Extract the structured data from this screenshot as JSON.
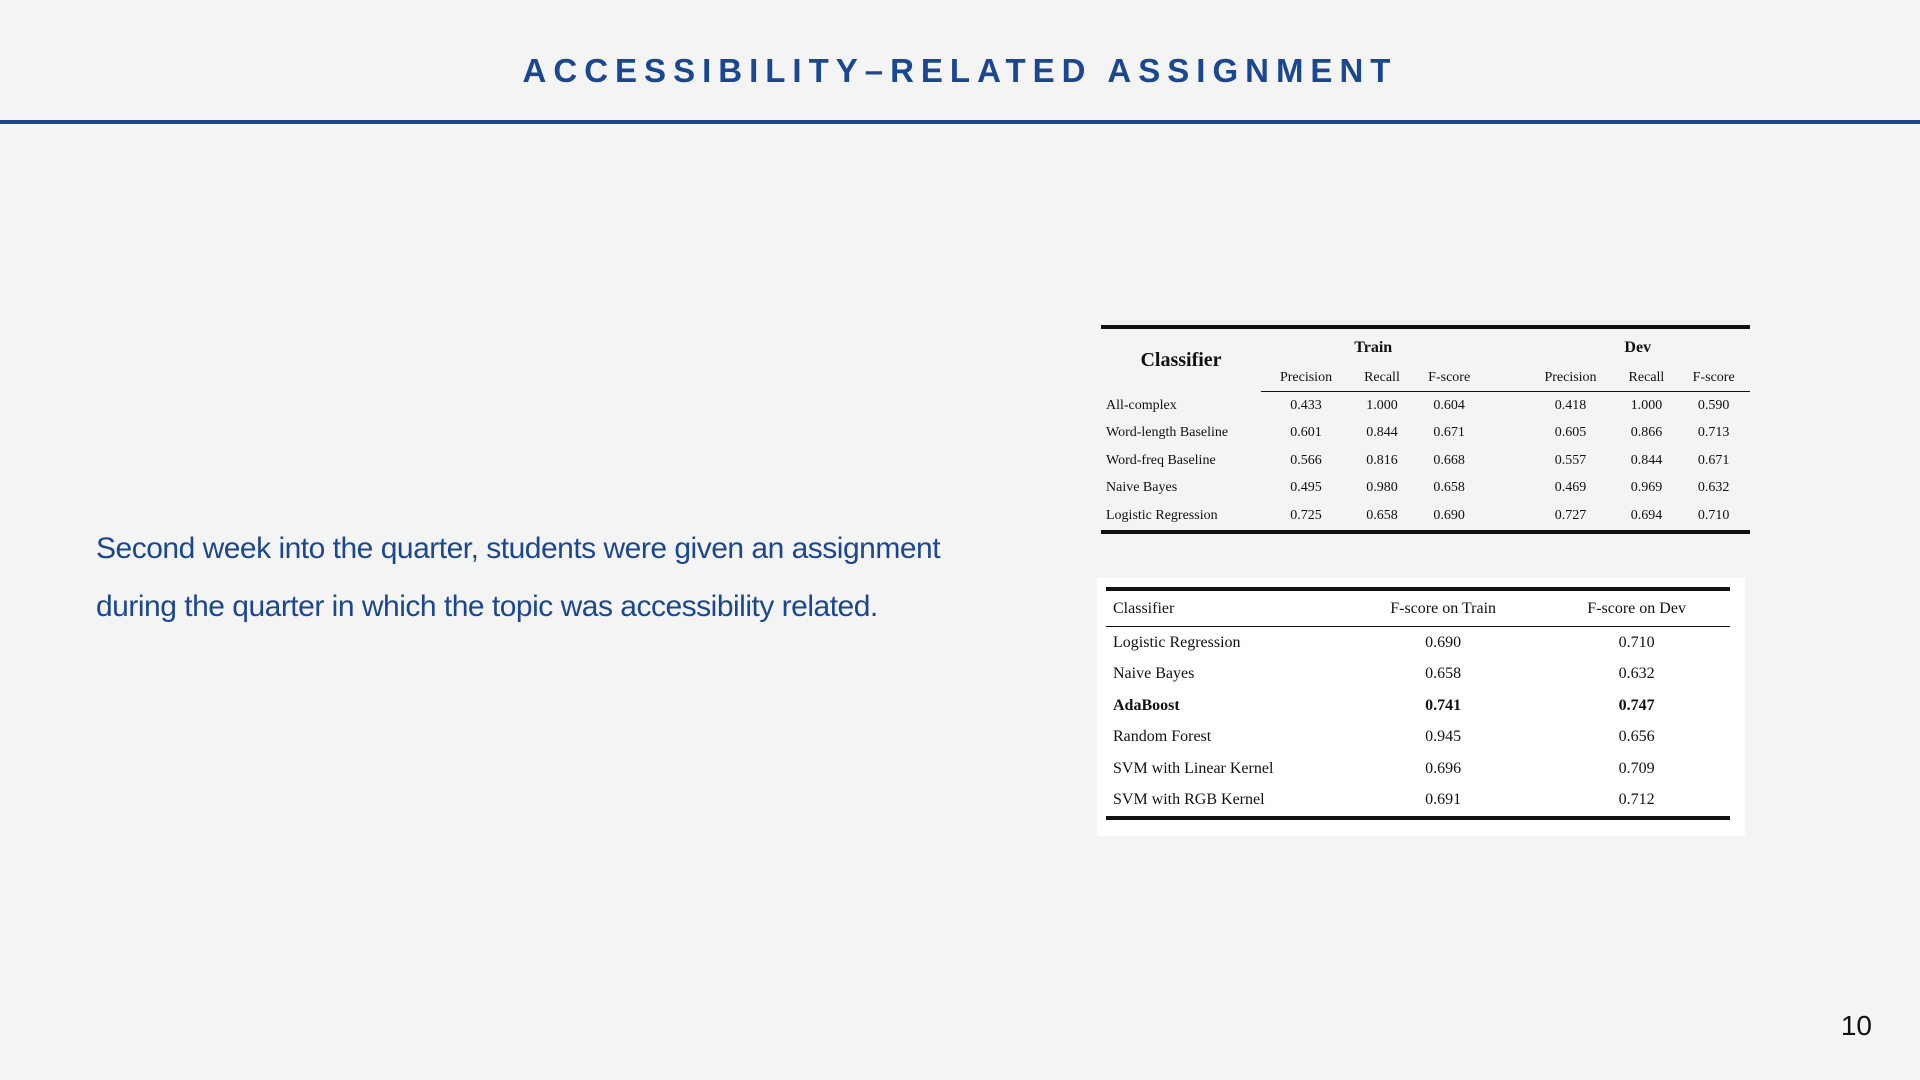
{
  "slide": {
    "title": "ACCESSIBILITY–RELATED ASSIGNMENT",
    "body_lines": [
      "Second week into the quarter, students were given an assignment",
      "during the quarter in which the topic was accessibility related."
    ],
    "page_number": "10"
  },
  "table1": {
    "classifier_header": "Classifier",
    "groups": [
      "Train",
      "Dev"
    ],
    "subheaders": [
      "Precision",
      "Recall",
      "F-score",
      "Precision",
      "Recall",
      "F-score"
    ],
    "rows": [
      {
        "name": "All-complex",
        "values": [
          "0.433",
          "1.000",
          "0.604",
          "0.418",
          "1.000",
          "0.590"
        ]
      },
      {
        "name": "Word-length Baseline",
        "values": [
          "0.601",
          "0.844",
          "0.671",
          "0.605",
          "0.866",
          "0.713"
        ]
      },
      {
        "name": "Word-freq Baseline",
        "values": [
          "0.566",
          "0.816",
          "0.668",
          "0.557",
          "0.844",
          "0.671"
        ]
      },
      {
        "name": "Naive Bayes",
        "values": [
          "0.495",
          "0.980",
          "0.658",
          "0.469",
          "0.969",
          "0.632"
        ]
      },
      {
        "name": "Logistic Regression",
        "values": [
          "0.725",
          "0.658",
          "0.690",
          "0.727",
          "0.694",
          "0.710"
        ]
      }
    ]
  },
  "table2": {
    "headers": [
      "Classifier",
      "F-score on Train",
      "F-score on Dev"
    ],
    "rows": [
      {
        "name": "Logistic Regression",
        "train": "0.690",
        "dev": "0.710",
        "bold": false
      },
      {
        "name": "Naive Bayes",
        "train": "0.658",
        "dev": "0.632",
        "bold": false
      },
      {
        "name": "AdaBoost",
        "train": "0.741",
        "dev": "0.747",
        "bold": true
      },
      {
        "name": "Random Forest",
        "train": "0.945",
        "dev": "0.656",
        "bold": false
      },
      {
        "name": "SVM with Linear Kernel",
        "train": "0.696",
        "dev": "0.709",
        "bold": false
      },
      {
        "name": "SVM with RGB Kernel",
        "train": "0.691",
        "dev": "0.712",
        "bold": false
      }
    ]
  }
}
